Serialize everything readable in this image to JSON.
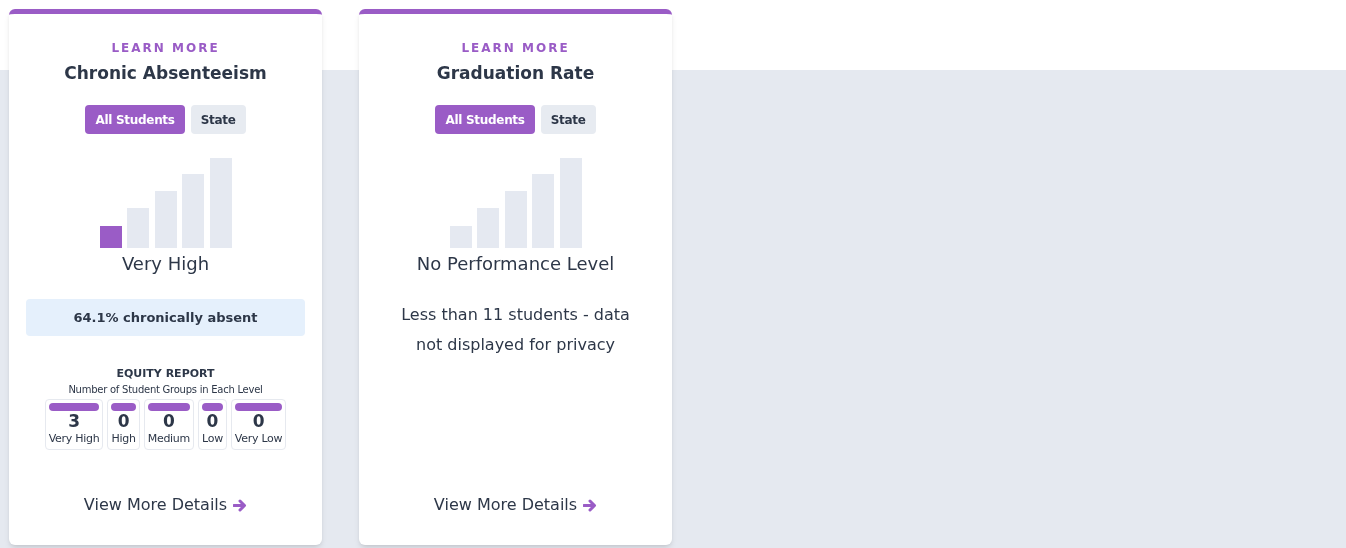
{
  "cards": [
    {
      "eyebrow": "LEARN MORE",
      "title": "Chronic Absenteeism",
      "toggles": [
        {
          "label": "All Students",
          "selected": true
        },
        {
          "label": "State",
          "selected": false
        }
      ],
      "level_bars": [
        {
          "filled": true
        },
        {
          "filled": false
        },
        {
          "filled": false
        },
        {
          "filled": false
        },
        {
          "filled": false
        }
      ],
      "level_label": "Very High",
      "value": "64.1% chronically absent",
      "equity_report": {
        "title": "EQUITY REPORT",
        "subtitle": "Number of Student Groups in Each Level",
        "groups": [
          {
            "count": "3",
            "label": "Very High"
          },
          {
            "count": "0",
            "label": "High"
          },
          {
            "count": "0",
            "label": "Medium"
          },
          {
            "count": "0",
            "label": "Low"
          },
          {
            "count": "0",
            "label": "Very Low"
          }
        ]
      },
      "link": "View More Details"
    },
    {
      "eyebrow": "LEARN MORE",
      "title": "Graduation Rate",
      "toggles": [
        {
          "label": "All Students",
          "selected": true
        },
        {
          "label": "State",
          "selected": false
        }
      ],
      "level_bars": [
        {
          "filled": false
        },
        {
          "filled": false
        },
        {
          "filled": false
        },
        {
          "filled": false
        },
        {
          "filled": false
        }
      ],
      "level_label": "No Performance Level",
      "note": "Less than 11 students - data not displayed for privacy",
      "link": "View More Details"
    }
  ]
}
